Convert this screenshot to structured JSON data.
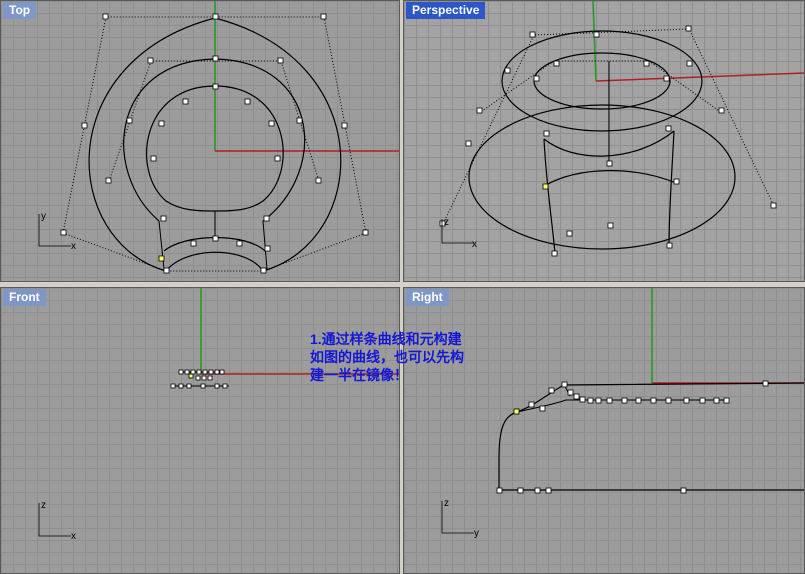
{
  "viewports": {
    "top": {
      "label": "Top",
      "active": false
    },
    "perspective": {
      "label": "Perspective",
      "active": true
    },
    "front": {
      "label": "Front",
      "active": false
    },
    "right": {
      "label": "Right",
      "active": false
    }
  },
  "axes": {
    "top": {
      "h": "x",
      "v": "y"
    },
    "perspective": {
      "h": "x",
      "v": "z"
    },
    "front": {
      "h": "x",
      "v": "z"
    },
    "right": {
      "h": "y",
      "v": "z"
    }
  },
  "annotation": {
    "text": "1.通过样条曲线和元构建\n如图的曲线，也可以先构\n建一半在镜像！"
  },
  "colors": {
    "viewport_bg": "#9c9c9c",
    "grid": "#8f8f8f",
    "x_axis": "#b02020",
    "y_axis": "#1f9a1f",
    "curve": "#000000",
    "control_polygon": "#000000",
    "selected_point": "#ffff60",
    "label_active_bg": "#2d56c8",
    "label_inactive_bg": "#7f96c9",
    "annotation": "#1418d6"
  }
}
